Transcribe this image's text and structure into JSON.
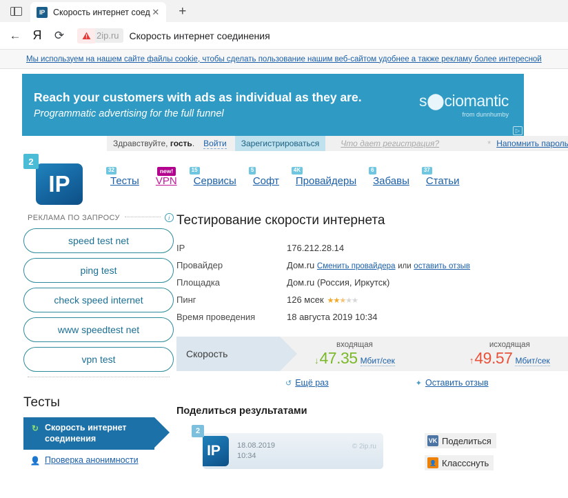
{
  "browser": {
    "sidebar_toggle_icon": "panel-icon",
    "tab": {
      "favicon_text": "IP",
      "title": "Скорость интернет соед",
      "close_icon": "✕"
    },
    "new_tab_icon": "+",
    "toolbar": {
      "back_icon": "←",
      "yandex_icon": "Я",
      "reload_icon": "⟳",
      "security_icon": "warning-triangle",
      "domain": "2ip.ru",
      "page_title": "Скорость интернет соединения"
    }
  },
  "cookie_notice": {
    "text": "Мы используем на нашем сайте файлы cookie, чтобы сделать пользование нашим веб-сайтом удобнее а также рекламу более интересной"
  },
  "ad_banner": {
    "headline": "Reach your customers with ads as individual as they are.",
    "subline": "Programmatic advertising for the full funnel",
    "brand": "s⬤ciomantic",
    "brand_tagline": "from dunnhumby",
    "adchoices_icon": "▷",
    "background_color": "#2f9bc4"
  },
  "user_bar": {
    "greeting_prefix": "Здравствуйте, ",
    "greeting_user": "гость",
    "greeting_suffix": ".",
    "login": "Войти",
    "register": "Зарегистрироваться",
    "what_registration_gives": "Что дает регистрация?",
    "asterisk": "*",
    "remind_password": "Напомнить пароль"
  },
  "logo": {
    "badge": "2",
    "mark": "IP"
  },
  "nav": {
    "items": [
      {
        "label": "Тесты",
        "badge": "32",
        "accent": false
      },
      {
        "label": "VPN",
        "badge": "new!",
        "accent": true
      },
      {
        "label": "Сервисы",
        "badge": "15",
        "accent": false
      },
      {
        "label": "Софт",
        "badge": "5",
        "accent": false
      },
      {
        "label": "Провайдеры",
        "badge": "4K",
        "accent": false
      },
      {
        "label": "Забавы",
        "badge": "6",
        "accent": false
      },
      {
        "label": "Статьи",
        "badge": "37",
        "accent": false
      }
    ]
  },
  "promo": {
    "header": "РЕКЛАМА ПО ЗАПРОСУ",
    "info_icon": "i",
    "buttons": [
      "speed test net",
      "ping test",
      "check speed internet",
      "www speedtest net",
      "vpn test"
    ]
  },
  "tests_sidebar": {
    "title": "Тесты",
    "items": [
      {
        "label": "Скорость интернет соединения",
        "icon": "speed-arrow-icon",
        "active": true
      },
      {
        "label": "Проверка анонимности",
        "icon": "person-icon",
        "active": false
      }
    ]
  },
  "main": {
    "page_title": "Тестирование скорости интернета",
    "info_rows": [
      {
        "label": "IP",
        "value": "176.212.28.14"
      },
      {
        "label": "Провайдер",
        "value": "Дом.ru"
      },
      {
        "label": "Площадка",
        "value": "Дом.ru (Россия, Иркутск)"
      },
      {
        "label": "Пинг",
        "value": "126 мсек"
      },
      {
        "label": "Время проведения",
        "value": "18 августа 2019 10:34"
      }
    ],
    "provider_change_link": "Сменить провайдера",
    "provider_or": "или",
    "provider_review_link": "оставить отзыв",
    "ping_rating": 2.5,
    "ping_rating_max": 5,
    "speed": {
      "label": "Скорость",
      "download_caption": "входящая",
      "download_arrow": "↓",
      "download_value": "47.35",
      "download_unit": "Мбит/сек",
      "download_color": "#7bb82a",
      "upload_caption": "исходящая",
      "upload_arrow": "↑",
      "upload_value": "49.57",
      "upload_unit": "Мбит/сек",
      "upload_color": "#e8533b"
    },
    "actions": {
      "retry_icon": "↺",
      "retry_label": "Ещё раз",
      "review_icon": "✦",
      "review_label": "Оставить отзыв"
    }
  },
  "share": {
    "title": "Поделиться результатами",
    "card": {
      "badge": "2",
      "logo": "IP",
      "date": "18.08.2019",
      "time": "10:34",
      "watermark": "© 2ip.ru"
    },
    "buttons": [
      {
        "label": "Поделиться",
        "network": "vk",
        "icon": "vk-icon"
      },
      {
        "label": "Классснуть",
        "network": "ok",
        "icon": "ok-icon"
      }
    ]
  }
}
